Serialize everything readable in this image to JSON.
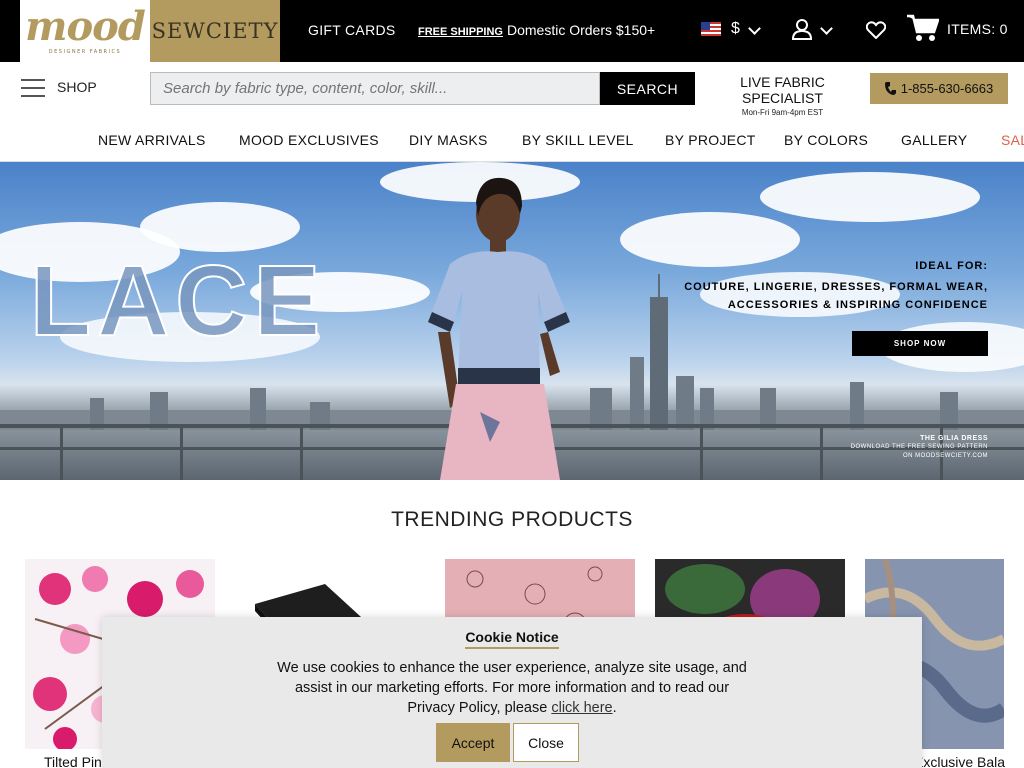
{
  "header": {
    "logo_mood_text": "mood",
    "logo_mood_sub": "DESIGNER FABRICS",
    "logo_sewciety_text": "SEWCIETY",
    "gift_cards": "GIFT CARDS",
    "free_shipping_label": "FREE SHIPPING",
    "free_shipping_text": "Domestic Orders $150+",
    "currency": "$",
    "cart_label": "ITEMS: 0"
  },
  "toolbar": {
    "shop_label": "SHOP",
    "search_placeholder": "Search by fabric type, content, color, skill...",
    "search_button": "SEARCH",
    "specialist_title": "LIVE FABRIC SPECIALIST",
    "specialist_hours": "Mon-Fri 9am-4pm EST",
    "phone": "1-855-630-6663"
  },
  "nav": {
    "items": [
      "NEW ARRIVALS",
      "MOOD EXCLUSIVES",
      "DIY MASKS",
      "BY SKILL LEVEL",
      "BY PROJECT",
      "BY COLORS",
      "GALLERY",
      "SALE"
    ],
    "sale_color": "#e0604c"
  },
  "hero": {
    "headline": "LACE",
    "ideal_title": "IDEAL FOR:",
    "ideal_line1": "COUTURE, LINGERIE, DRESSES, FORMAL WEAR,",
    "ideal_line2": "ACCESSORIES & INSPIRING CONFIDENCE",
    "cta": "SHOP NOW",
    "credit_line1": "THE GILIA DRESS",
    "credit_line2": "DOWNLOAD THE FREE SEWING PATTERN",
    "credit_line3": "ON MOODSEWCIETY.COM"
  },
  "trending": {
    "title": "TRENDING PRODUCTS",
    "products": [
      {
        "name": "Tilted Pin"
      },
      {
        "name": ""
      },
      {
        "name": ""
      },
      {
        "name": ""
      },
      {
        "name": "Exclusive Bala"
      }
    ]
  },
  "cookie": {
    "title": "Cookie Notice",
    "text": "We use cookies to enhance the user experience, analyze site usage, and assist in our marketing efforts. For more information and to read our Privacy Policy, please",
    "link": "click here",
    "period": ".",
    "accept": "Accept",
    "close": "Close"
  },
  "colors": {
    "brand_gold": "#b39a5f",
    "topbar_bg": "#000000"
  }
}
